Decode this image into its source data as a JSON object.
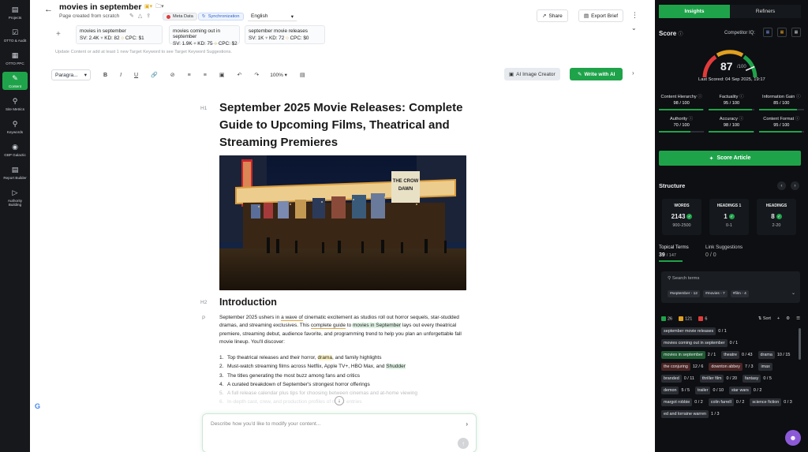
{
  "leftnav": [
    {
      "label": "Projects",
      "icon": "document-icon"
    },
    {
      "label": "OTTO & Audit",
      "icon": "audit-icon"
    },
    {
      "label": "OTTO PPC",
      "icon": "ppc-icon"
    },
    {
      "label": "Content",
      "icon": "pen-icon",
      "active": true
    },
    {
      "label": "Site Metrics",
      "icon": "magnifier-icon"
    },
    {
      "label": "Keywords",
      "icon": "key-icon"
    },
    {
      "label": "GBP Galactic",
      "icon": "map-pin-icon"
    },
    {
      "label": "Report Builder",
      "icon": "report-icon"
    },
    {
      "label": "Authority Building",
      "icon": "megaphone-icon"
    }
  ],
  "header": {
    "title": "movies in september",
    "subtitle": "Page created from scratch",
    "meta_chip": "Meta Data",
    "sync_chip": "Synchronization",
    "language": "English",
    "share": "Share",
    "export": "Export Brief"
  },
  "keywords": [
    {
      "kw": "movies in september",
      "sv": "SV: 2.4K",
      "kd": "KD: 82",
      "cpc": "CPC: $1"
    },
    {
      "kw": "movies coming out in september",
      "sv": "SV: 1.9K",
      "kd": "KD: 75",
      "cpc": "CPC: $2"
    },
    {
      "kw": "september movie releases",
      "sv": "SV: 1K",
      "kd": "KD: 72",
      "cpc": "CPC: $0"
    }
  ],
  "kw_hint": "Update Content or add at least 1 new Target Keyword to see Target Keyword Suggestions.",
  "toolbar": {
    "paragraph": "Paragra...",
    "zoom": "100%",
    "ai_image": "AI Image Creator",
    "write_ai": "Write with AI"
  },
  "doc": {
    "tag_h1": "H1",
    "h1": "September 2025 Movie Releases: Complete Guide to Upcoming Films, Theatrical and Streaming Premieres",
    "tag_h2": "H2",
    "h2": "Introduction",
    "tag_p": "P",
    "p_1": "September 2025 ushers in ",
    "p_u1": "a wave of",
    "p_2": " cinematic excitement as studios roll out horror sequels, star-studded dramas, and streaming exclusives. This ",
    "p_u2": "complete guide",
    "p_3": " to ",
    "p_hl": "movies in September",
    "p_4": " lays out every theatrical premiere, streaming debut, audience favorite, and programming trend to help you plan an unforgettable fall movie lineup. You'll discover:",
    "list": [
      {
        "n": "1.",
        "a": "Top theatrical releases and their horror, ",
        "b": "drama",
        "c": ", and family highlights"
      },
      {
        "n": "2.",
        "a": "Must-watch streaming films across Netflix, Apple TV+, HBO Max, and ",
        "b": "Shudder",
        "c": ""
      },
      {
        "n": "3.",
        "a": "The titles generating the most buzz among fans and critics",
        "b": "",
        "c": ""
      },
      {
        "n": "4.",
        "a": "A curated breakdown of September's strongest horror offerings",
        "b": "",
        "c": ""
      },
      {
        "n": "5.",
        "a": "A full release calendar plus tips for choosing between cinemas and at-home viewing",
        "b": "",
        "c": ""
      },
      {
        "n": "6.",
        "a": "In-depth cast, crew, and production profiles of major entries",
        "b": "",
        "c": ""
      }
    ],
    "prompt_placeholder": "Describe how you'd like to modify your content..."
  },
  "right": {
    "tab_insights": "Insights",
    "tab_refiners": "Refiners",
    "score_label": "Score",
    "competitor_iq": "Competitor IQ:",
    "score": "87",
    "score_den": "/100",
    "score_fraction": 0.87,
    "last_scored": "Last Scored: 04 Sep 2025, 19:17",
    "metrics": [
      {
        "name": "Content Hierarchy",
        "val": "98 / 100",
        "pct": 98
      },
      {
        "name": "Factuality",
        "val": "95 / 100",
        "pct": 95
      },
      {
        "name": "Information Gain",
        "val": "85 / 100",
        "pct": 85
      },
      {
        "name": "Authority",
        "val": "70 / 100",
        "pct": 70
      },
      {
        "name": "Accuracy",
        "val": "98 / 100",
        "pct": 98
      },
      {
        "name": "Content Format",
        "val": "95 / 100",
        "pct": 95
      }
    ],
    "score_btn": "Score Article",
    "structure": "Structure",
    "stats": [
      {
        "name": "WORDS",
        "val": "2143",
        "range": "900-2500"
      },
      {
        "name": "HEADINGS 1",
        "val": "1",
        "range": "0-1"
      },
      {
        "name": "HEADINGS",
        "val": "8",
        "range": "2-20"
      }
    ],
    "topical_tab": "Topical Terms",
    "topical_count": "39",
    "topical_total": "/ 147",
    "link_tab": "Link Suggestions",
    "link_count": "0",
    "link_total": "/ 0",
    "search_placeholder": "Search terms",
    "tags": [
      "#september - 12",
      "#movies - 7",
      "#film - 4"
    ],
    "filter": {
      "green": "26",
      "yellow": "121",
      "red": "6",
      "sort": "Sort"
    },
    "terms": [
      {
        "t": "september movie releases",
        "c": "0 / 1",
        "k": ""
      },
      {
        "t": "movies coming out in september",
        "c": "0 / 1",
        "k": ""
      },
      {
        "t": "movies in september",
        "c": "2 / 1",
        "k": "g"
      },
      {
        "t": "theatre",
        "c": "0 / 43",
        "k": ""
      },
      {
        "t": "drama",
        "c": "10 / 15",
        "k": ""
      },
      {
        "t": "the conjuring",
        "c": "12 / 6",
        "k": "r"
      },
      {
        "t": "downton abbey",
        "c": "7 / 3",
        "k": "r"
      },
      {
        "t": "imax",
        "c": "",
        "k": ""
      },
      {
        "t": "branded",
        "c": "0 / 11",
        "k": ""
      },
      {
        "t": "thriller film",
        "c": "0 / 20",
        "k": ""
      },
      {
        "t": "fantasy",
        "c": "0 / 5",
        "k": ""
      },
      {
        "t": "demon",
        "c": "5 / 5",
        "k": ""
      },
      {
        "t": "trailer",
        "c": "0 / 10",
        "k": ""
      },
      {
        "t": "star wars",
        "c": "0 / 2",
        "k": ""
      },
      {
        "t": "margot robbie",
        "c": "0 / 2",
        "k": ""
      },
      {
        "t": "colin farrell",
        "c": "0 / 2",
        "k": ""
      },
      {
        "t": "science fiction",
        "c": "0 / 3",
        "k": ""
      },
      {
        "t": "ed and lorraine warren",
        "c": "1 / 3",
        "k": ""
      }
    ]
  },
  "hero_marquee": "THE CROW DAWN"
}
